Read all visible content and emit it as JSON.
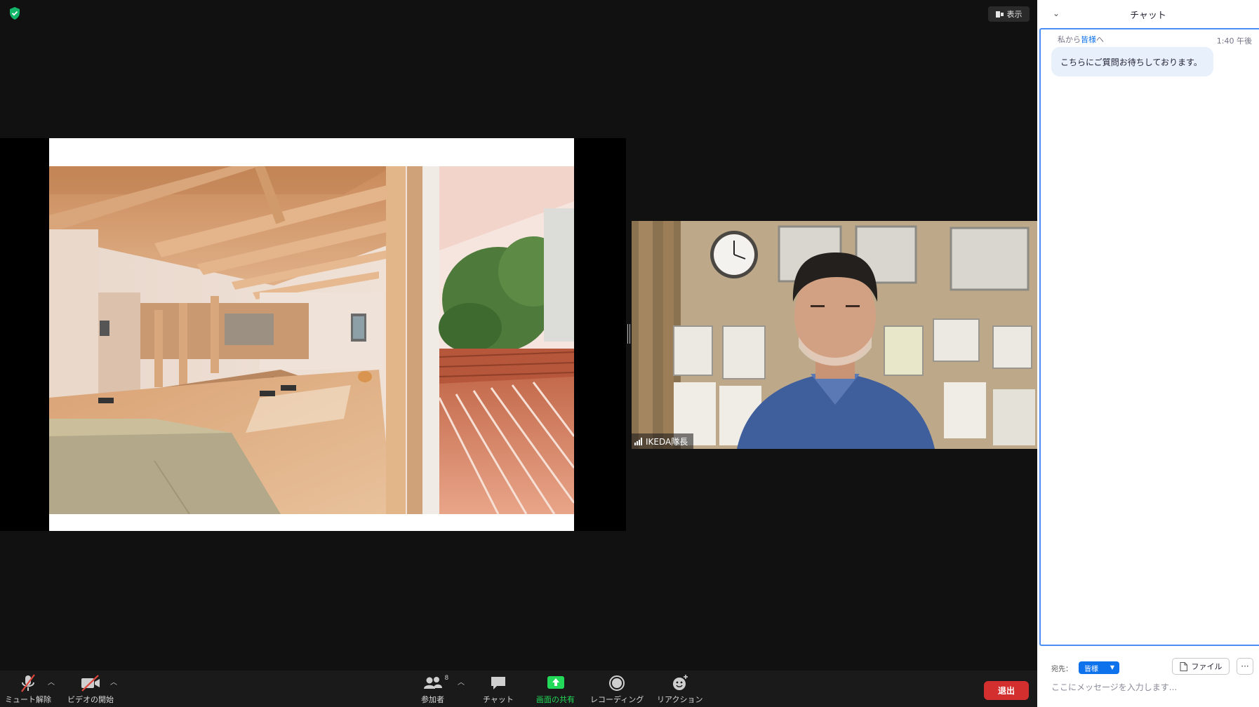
{
  "stage": {
    "view_label": "表示",
    "speaker_name": "IKEDA隊長"
  },
  "toolbar": {
    "mute_label": "ミュート解除",
    "video_label": "ビデオの開始",
    "participants_label": "参加者",
    "participants_count": "8",
    "chat_label": "チャット",
    "share_label": "画面の共有",
    "record_label": "レコーディング",
    "reaction_label": "リアクション",
    "leave_label": "退出"
  },
  "chat": {
    "title": "チャット",
    "messages": [
      {
        "sender": "私から",
        "recipient": "皆様",
        "suffix": "へ",
        "time": "1:40 午後",
        "text": "こちらにご質問お待ちしております。"
      }
    ],
    "to_label": "宛先：",
    "to_value": "皆様",
    "file_label": "ファイル",
    "more_label": "···",
    "input_placeholder": "ここにメッセージを入力します..."
  },
  "colors": {
    "accent": "#0e72ed",
    "share_green": "#23d959",
    "leave_red": "#d32f2f",
    "shield_green": "#12b76a"
  }
}
